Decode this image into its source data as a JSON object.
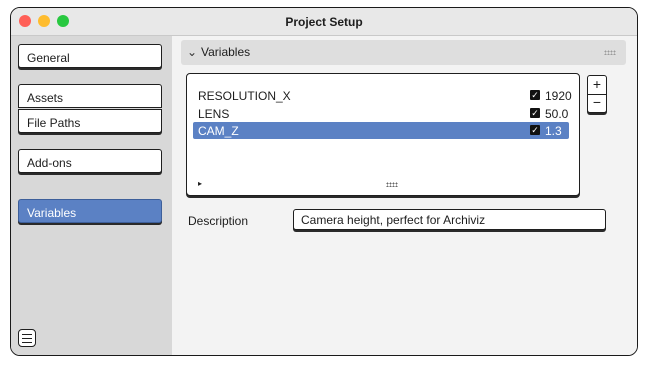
{
  "window": {
    "title": "Project Setup"
  },
  "sidebar": {
    "items": [
      {
        "label": "General"
      },
      {
        "label": "Assets"
      },
      {
        "label": "File Paths"
      },
      {
        "label": "Add-ons"
      },
      {
        "label": "Variables",
        "active": true
      }
    ],
    "menu_icon": "hamburger-icon"
  },
  "panel": {
    "title": "Variables",
    "collapse_icon": "chevron-down-icon",
    "variables": [
      {
        "name": "RESOLUTION_X",
        "enabled": true,
        "value": "1920"
      },
      {
        "name": "LENS",
        "enabled": true,
        "value": "50.0"
      },
      {
        "name": "CAM_Z",
        "enabled": true,
        "value": "1.3",
        "selected": true
      }
    ],
    "add_label": "+",
    "remove_label": "−",
    "play_icon": "▸"
  },
  "description": {
    "label": "Description",
    "value": "Camera height, perfect for Archiviz"
  },
  "colors": {
    "accent": "#5b81c4",
    "sidebar_bg": "#d8d8d8",
    "close": "#ff5f57",
    "minimize": "#febc2e",
    "maximize": "#28c840"
  }
}
